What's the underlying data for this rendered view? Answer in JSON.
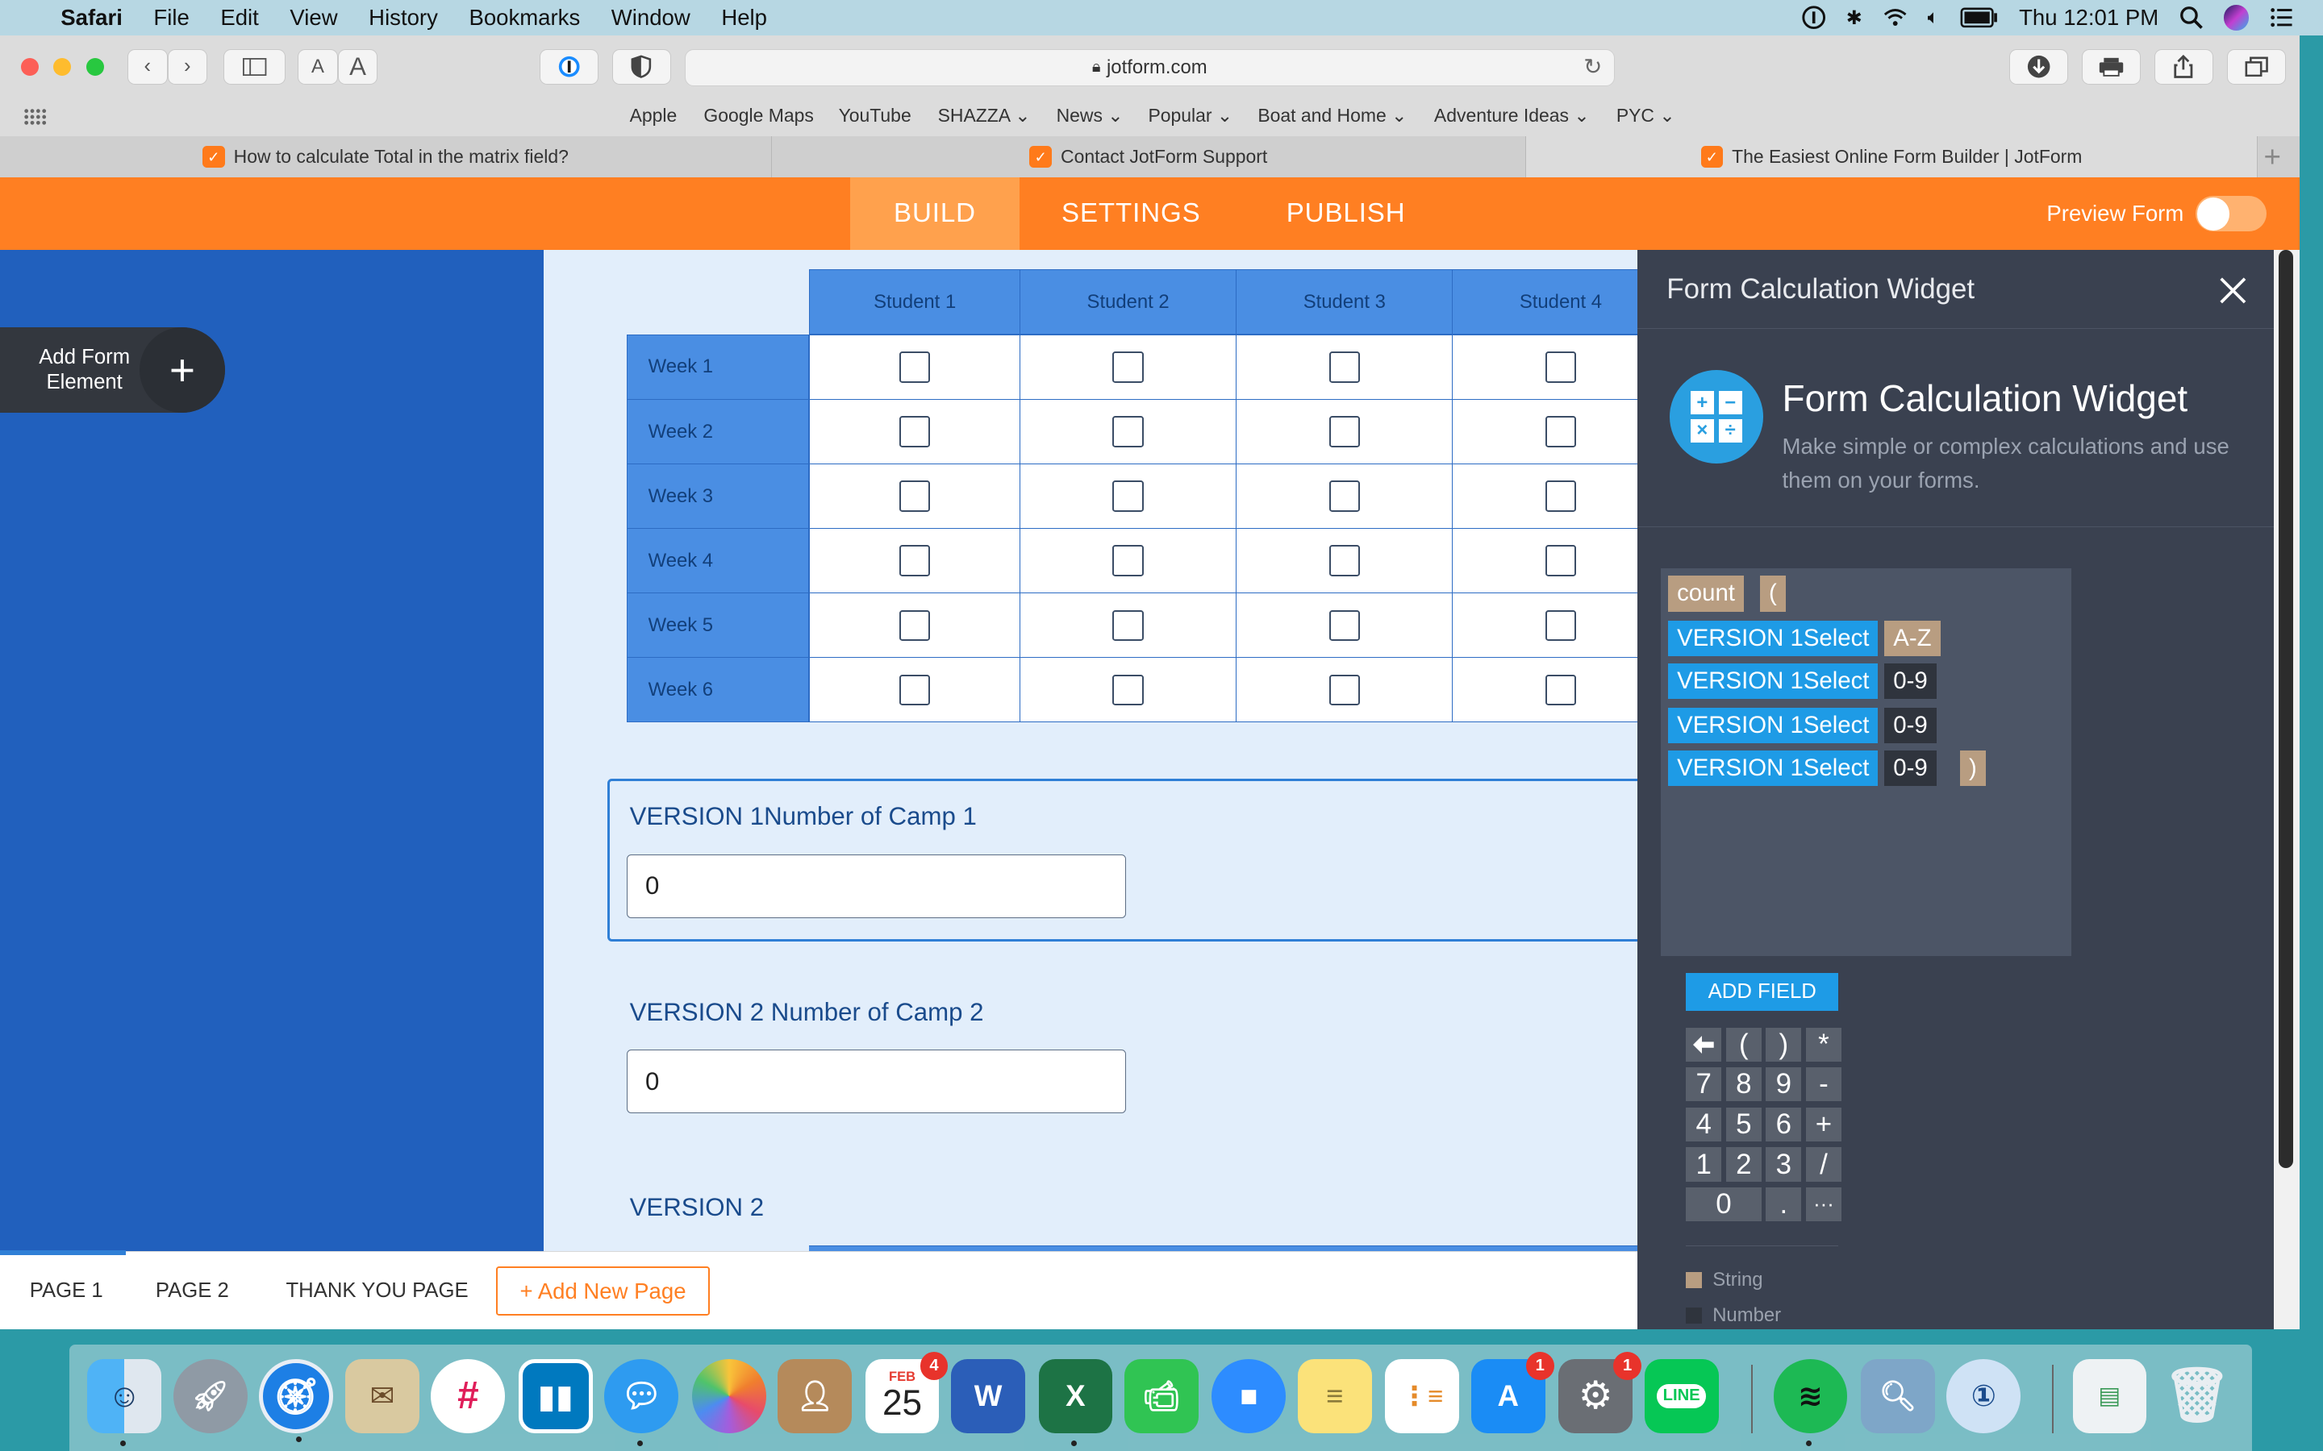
{
  "menubar": {
    "app": "Safari",
    "items": [
      "File",
      "Edit",
      "View",
      "History",
      "Bookmarks",
      "Window",
      "Help"
    ],
    "clock": "Thu 12:01 PM"
  },
  "browser": {
    "url": "jotform.com",
    "bookmarks": [
      "Apple",
      "Google Maps",
      "YouTube",
      "SHAZZA",
      "News",
      "Popular",
      "Boat and Home",
      "Adventure Ideas",
      "PYC"
    ],
    "tabs": [
      {
        "title": "How to calculate Total in the matrix field?"
      },
      {
        "title": "Contact JotForm Support"
      },
      {
        "title": "The Easiest Online Form Builder | JotForm"
      }
    ],
    "reader_small": "A",
    "reader_large": "A"
  },
  "header": {
    "build": "BUILD",
    "settings": "SETTINGS",
    "publish": "PUBLISH",
    "preview": "Preview Form"
  },
  "left_panel": {
    "add_element": "Add Form Element",
    "add_symbol": "+"
  },
  "matrix": {
    "columns": [
      "Student 1",
      "Student 2",
      "Student 3",
      "Student 4"
    ],
    "rows": [
      "Week 1",
      "Week 2",
      "Week 3",
      "Week 4",
      "Week 5",
      "Week 6"
    ]
  },
  "fields": [
    {
      "label": "VERSION 1Number of Camp 1",
      "value": "0"
    },
    {
      "label": "VERSION 2 Number of Camp 2",
      "value": "0"
    },
    {
      "label": "VERSION 2"
    }
  ],
  "widget": {
    "header": "Form Calculation Widget",
    "title": "Form Calculation Widget",
    "description": "Make simple or complex calculations and use them on your forms.",
    "tokens": {
      "count": "count",
      "open": "(",
      "close": ")",
      "field1": "VERSION 1Select",
      "field2": "VERSION 1Select",
      "field3": "VERSION 1Select",
      "field4": "VERSION 1Select",
      "type1": "A-Z",
      "type2": "0-9",
      "type3": "0-9",
      "type4": "0-9"
    },
    "add_field": "ADD FIELD",
    "keys": [
      "(",
      ")",
      "*",
      "7",
      "8",
      "9",
      "-",
      "4",
      "5",
      "6",
      "+",
      "1",
      "2",
      "3",
      "/",
      "0",
      ".",
      "···"
    ],
    "legend": [
      {
        "label": "String",
        "color": "#b89d81"
      },
      {
        "label": "Number",
        "color": "#2f343d"
      }
    ]
  },
  "pages": {
    "tabs": [
      "PAGE 1",
      "PAGE 2",
      "THANK YOU PAGE"
    ],
    "add_page": "+ Add New Page"
  },
  "dock": {
    "calendar_month": "FEB",
    "calendar_day": "25",
    "calendar_badge": "4",
    "appstore_badge": "1",
    "settings_badge": "1",
    "line_label": "LINE"
  },
  "colors": {
    "jotform_orange": "#ff7f22",
    "left_panel_blue": "#2160bd",
    "widget_dark": "#3a4150",
    "field_token_blue": "#1e9be6"
  }
}
